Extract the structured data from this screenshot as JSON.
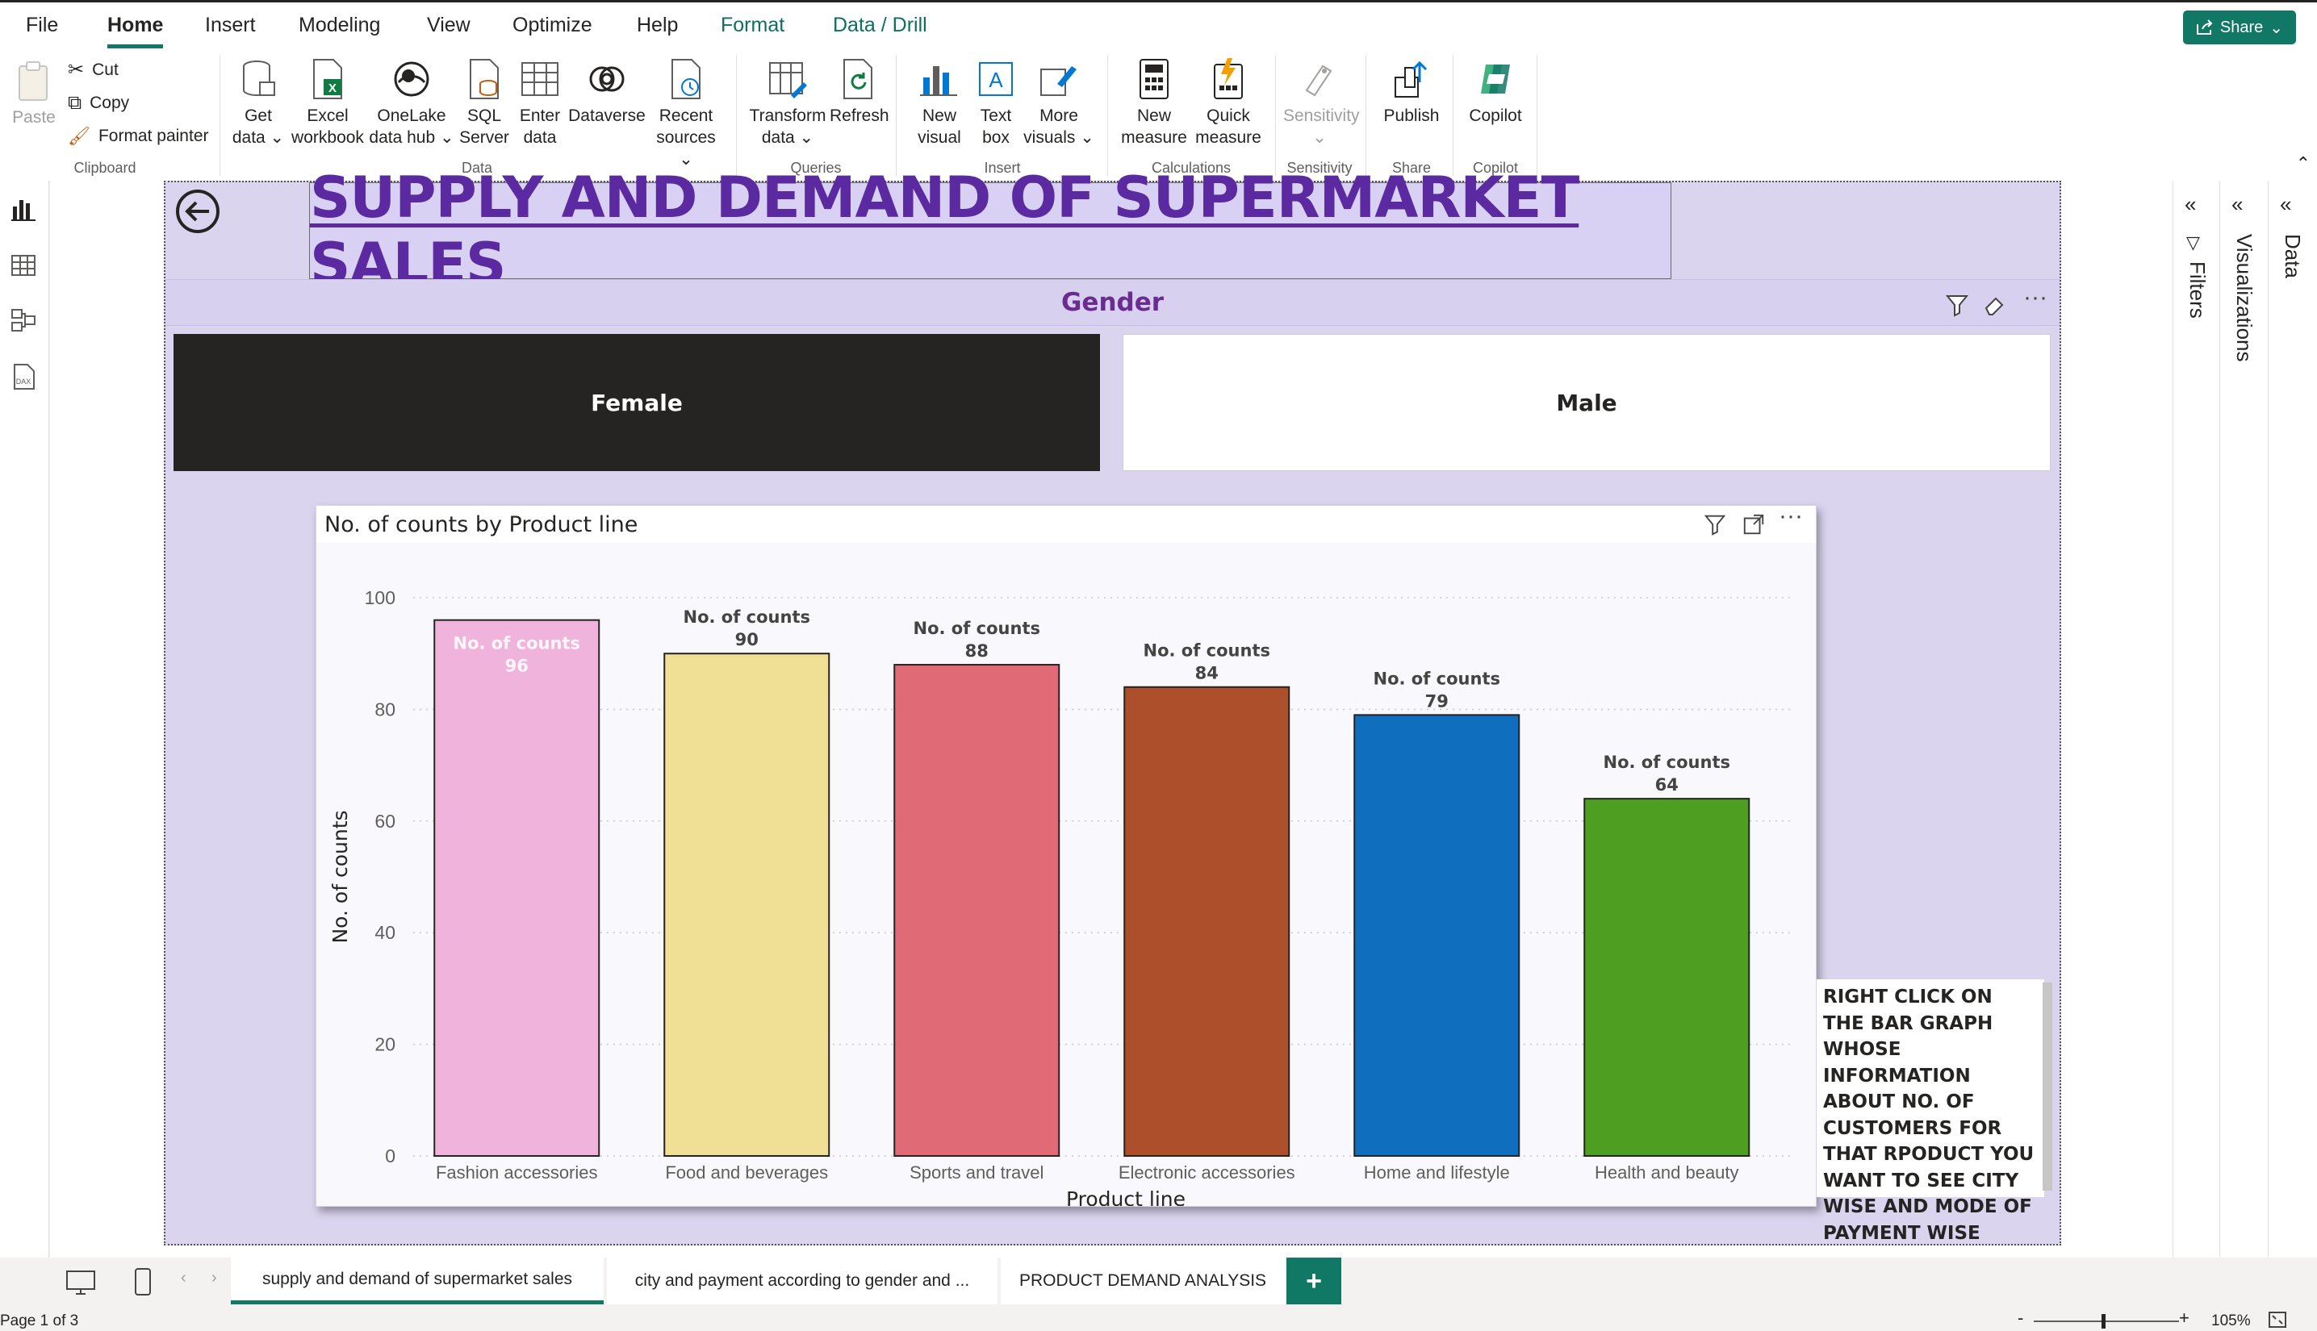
{
  "menu": {
    "items": [
      "File",
      "Home",
      "Insert",
      "Modeling",
      "View",
      "Optimize",
      "Help",
      "Format",
      "Data / Drill"
    ],
    "share_label": "Share"
  },
  "ribbon": {
    "clipboard": {
      "paste": "Paste",
      "cut": "Cut",
      "copy": "Copy",
      "format_painter": "Format painter",
      "group": "Clipboard"
    },
    "data": {
      "get_data": [
        "Get",
        "data"
      ],
      "excel": [
        "Excel",
        "workbook"
      ],
      "onelake": [
        "OneLake",
        "data hub"
      ],
      "sql": [
        "SQL",
        "Server"
      ],
      "enter": [
        "Enter",
        "data"
      ],
      "dataverse": "Dataverse",
      "recent": [
        "Recent",
        "sources"
      ],
      "group": "Data"
    },
    "queries": {
      "transform": [
        "Transform",
        "data"
      ],
      "refresh": "Refresh",
      "group": "Queries"
    },
    "insert": {
      "new_visual": [
        "New",
        "visual"
      ],
      "text_box": [
        "Text",
        "box"
      ],
      "more_visuals": [
        "More",
        "visuals"
      ],
      "group": "Insert"
    },
    "calculations": {
      "new_measure": [
        "New",
        "measure"
      ],
      "quick_measure": [
        "Quick",
        "measure"
      ],
      "group": "Calculations"
    },
    "sensitivity": {
      "label": "Sensitivity",
      "group": "Sensitivity"
    },
    "share": {
      "publish": "Publish",
      "group": "Share"
    },
    "copilot": {
      "label": "Copilot",
      "group": "Copilot"
    }
  },
  "report": {
    "title": "SUPPLY AND DEMAND OF SUPERMARKET SALES",
    "slicer": {
      "title": "Gender",
      "options": [
        "Female",
        "Male"
      ],
      "selected": "Female"
    },
    "chart_title": "No. of counts by Product line",
    "note": "RIGHT CLICK ON THE BAR GRAPH WHOSE INFORMATION ABOUT NO. OF CUSTOMERS FOR THAT RPODUCT YOU WANT TO SEE CITY WISE AND MODE OF PAYMENT WISE"
  },
  "chart_data": {
    "type": "bar",
    "title": "No. of counts by Product line",
    "xlabel": "Product line",
    "ylabel": "No. of counts",
    "ylim": [
      0,
      100
    ],
    "yticks": [
      0,
      20,
      40,
      60,
      80,
      100
    ],
    "grid": true,
    "categories": [
      "Fashion accessories",
      "Food and beverages",
      "Sports and travel",
      "Electronic accessories",
      "Home and lifestyle",
      "Health and beauty"
    ],
    "values": [
      96,
      90,
      88,
      84,
      79,
      64
    ],
    "data_label_name": "No. of counts",
    "colors": [
      "#f0b3db",
      "#f0e096",
      "#e06a75",
      "#ac4f2a",
      "#106ebe",
      "#4e9f21"
    ]
  },
  "panes": {
    "filters": "Filters",
    "visualizations": "Visualizations",
    "data": "Data"
  },
  "tabs": [
    "supply and demand of supermarket sales",
    "city and payment according to gender and ...",
    "PRODUCT DEMAND ANALYSIS"
  ],
  "add_tab": "+",
  "status": {
    "page": "Page 1 of 3",
    "zoom": "105%",
    "zoom_minus": "-",
    "zoom_plus": "+"
  }
}
